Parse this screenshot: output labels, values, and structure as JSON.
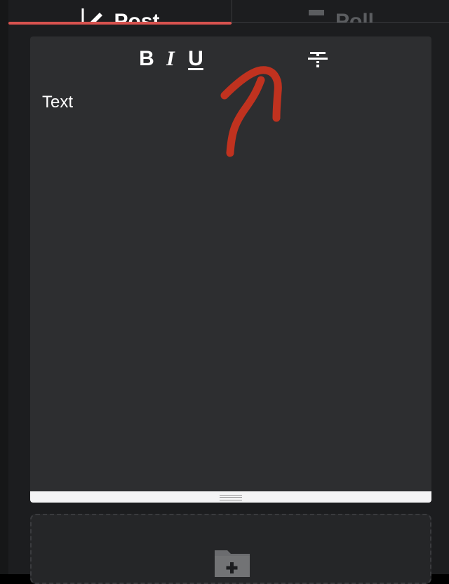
{
  "tabs": [
    {
      "label": "Post",
      "icon": "edit-icon",
      "active": true
    },
    {
      "label": "Poll",
      "icon": "poll-icon",
      "active": false
    }
  ],
  "toolbar": {
    "bold_label": "B",
    "italic_label": "I",
    "underline_label": "U",
    "strike_icon": "strikethrough-icon"
  },
  "editor": {
    "text": "Text"
  },
  "colors": {
    "accent": "#d9534f",
    "annotation": "#c0321f",
    "background": "#1c1d1f",
    "panel": "#2d2e30"
  },
  "dropzone": {
    "icon": "folder-add-icon"
  }
}
